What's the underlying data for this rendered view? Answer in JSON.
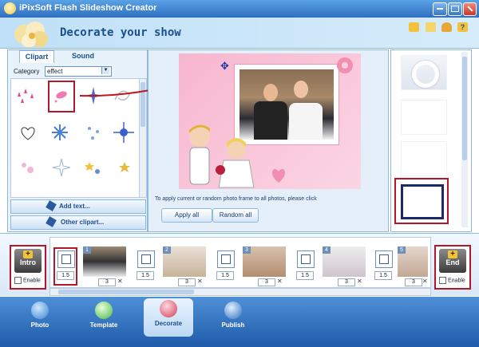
{
  "window": {
    "title": "iPixSoft Flash Slideshow Creator"
  },
  "header": {
    "title": "Decorate your show"
  },
  "left_panel": {
    "tabs": [
      {
        "label": "Clipart"
      },
      {
        "label": "Sound"
      }
    ],
    "category_label": "Category",
    "category_value": "effect",
    "add_text_label": "Add text...",
    "other_clipart_label": "Other clipart..."
  },
  "preview": {
    "apply_hint": "To apply current or random photo frame to all photos, please click",
    "apply_all_label": "Apply all",
    "random_all_label": "Random all"
  },
  "timeline": {
    "intro_label": "Intro",
    "end_label": "End",
    "enable_label": "Enable",
    "items": [
      {
        "transition": "1.5"
      },
      {
        "num": "1",
        "duration": "3"
      },
      {
        "transition": "1.5"
      },
      {
        "num": "2",
        "duration": "3"
      },
      {
        "transition": "1.5"
      },
      {
        "num": "3",
        "duration": "3"
      },
      {
        "transition": "1.5"
      },
      {
        "num": "4",
        "duration": "3"
      },
      {
        "transition": "1.5"
      },
      {
        "num": "5",
        "duration": "3"
      }
    ]
  },
  "nav": {
    "photo": "Photo",
    "template": "Template",
    "decorate": "Decorate",
    "publish": "Publish"
  },
  "colors": {
    "accent": "#2f6fc0",
    "highlight": "#b3172a",
    "stage_pink": "#f7b6cf"
  }
}
